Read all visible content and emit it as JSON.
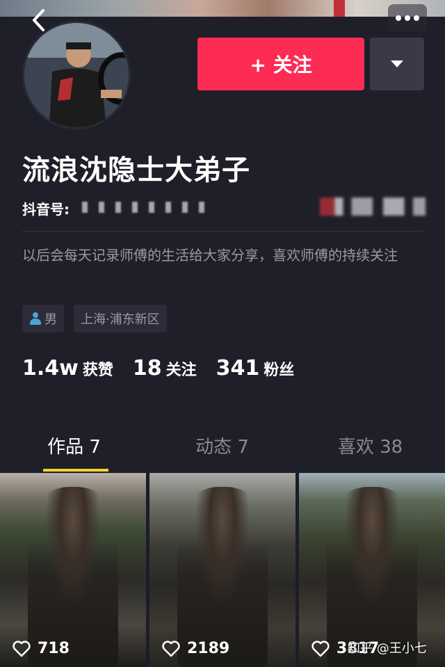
{
  "header": {
    "follow_label": "+ 关注",
    "name": "流浪沈隐士大弟子",
    "id_label": "抖音号:",
    "bio": "以后会每天记录师傅的生活给大家分享，喜欢师傅的持续关注",
    "tags": {
      "gender": "男",
      "location": "上海·浦东新区"
    }
  },
  "stats": [
    {
      "value": "1.4w",
      "label": "获赞"
    },
    {
      "value": "18",
      "label": "关注"
    },
    {
      "value": "341",
      "label": "粉丝"
    }
  ],
  "tabs": [
    {
      "label": "作品 7",
      "active": true
    },
    {
      "label": "动态 7",
      "active": false
    },
    {
      "label": "喜欢 38",
      "active": false
    }
  ],
  "videos": [
    {
      "likes": "718"
    },
    {
      "likes": "2189"
    },
    {
      "likes": "3817"
    }
  ],
  "watermark": "知乎 @王小七",
  "colors": {
    "accent": "#fd2c55",
    "tab_indicator": "#fcd232",
    "background": "#1f1f29"
  },
  "icons": {
    "back": "back-chevron-icon",
    "more": "more-dots-icon",
    "heart": "heart-outline-icon",
    "gender": "person-icon"
  }
}
